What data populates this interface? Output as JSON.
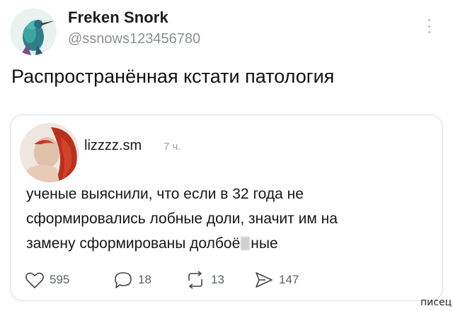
{
  "post": {
    "author": {
      "name": "Freken Snork",
      "handle": "@ssnows123456780"
    },
    "text": "Распространённая кстати патология"
  },
  "quote": {
    "author": {
      "name": "lizzzz.sm",
      "time": "7 ч."
    },
    "lines": [
      "ученые выяснили, что если в 32 года не",
      "сформировались лобные доли, значит им на"
    ],
    "last_line": {
      "before": "замену сформированы долбоё",
      "after": "ные"
    },
    "actions": {
      "likes": "595",
      "replies": "18",
      "reposts": "13",
      "views": "147"
    }
  },
  "watermark": "писец",
  "icons": [
    "more-icon",
    "heart-icon",
    "reply-icon",
    "repost-icon",
    "views-icon"
  ],
  "colors": {
    "muted": "#8a8f96",
    "border": "#d8dde1",
    "text": "#111111"
  }
}
